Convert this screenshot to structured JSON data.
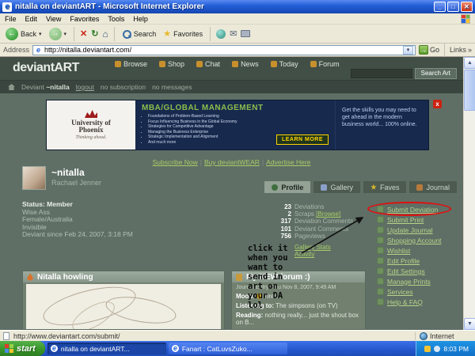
{
  "colors": {
    "xp_blue": "#2460d8",
    "start_green": "#389428",
    "da_header_bg": "#424f47",
    "da_page_bg": "#5f6f65",
    "da_link_green": "#a8cc66",
    "annotation_red": "#e01010",
    "ad_navy": "#17294d",
    "ad_yellow": "#ffd400"
  },
  "icons": {
    "back": "←",
    "forward": "→",
    "stop": "✕",
    "refresh": "↻",
    "home": "⌂",
    "favorites": "★",
    "mail": "✉",
    "dropdown": "▾",
    "go": "→",
    "links_chevron": "»",
    "minimize": "_",
    "maximize": "□",
    "close": "✕",
    "ie": "e",
    "scroll_up": "▲",
    "scroll_down": "▼",
    "ad_close": "x"
  },
  "titlebar": {
    "title": "nitalla on deviantART - Microsoft Internet Explorer"
  },
  "menubar": {
    "items": [
      "File",
      "Edit",
      "View",
      "Favorites",
      "Tools",
      "Help"
    ]
  },
  "toolbar": {
    "back_label": "Back",
    "search_label": "Search",
    "favorites_label": "Favorites"
  },
  "addressbar": {
    "label": "Address",
    "url": "http://nitalla.deviantart.com/",
    "go_label": "Go",
    "links_label": "Links"
  },
  "site_header": {
    "logo": "deviantART",
    "nav": [
      "Browse",
      "Shop",
      "Chat",
      "News",
      "Today",
      "Forum"
    ],
    "search_button": "Search Art"
  },
  "subnav": {
    "deviant_label": "Deviant",
    "username": "~nitalla",
    "logout": "logout",
    "subscription": "no subscription",
    "messages": "no messages"
  },
  "ad": {
    "brand_line1": "University of",
    "brand_line2": "Phoenix",
    "tagline": "Thinking ahead.",
    "title": "MBA/GLOBAL MANAGEMENT",
    "bullets": [
      "Foundations of Problem-Based Learning",
      "Focus Influencing Business in the Global Economy",
      "Strategies for Competitive Advantage",
      "Managing the Business Enterprise",
      "Strategic Implementation and Alignment",
      "And much more"
    ],
    "cta": "LEARN MORE",
    "offer": "Get the skills you may need to get ahead in the modern business world... 100% online."
  },
  "promo": {
    "links": [
      "Subscribe Now",
      "Buy deviantWEAR",
      "Advertise Here"
    ],
    "sep": "|"
  },
  "profile": {
    "username": "~nitalla",
    "realname": "Rachael Jenner",
    "tabs": [
      "Profile",
      "Gallery",
      "Faves",
      "Journal"
    ],
    "status": "Status: Member",
    "details": [
      "Wise Ass",
      "Female/Australia",
      "Invisible",
      "Deviant since Feb 24, 2007, 3:18 PM"
    ],
    "stats": [
      {
        "value": "23",
        "label": "Deviations"
      },
      {
        "value": "2",
        "label": "Scraps",
        "link": "[Browse]"
      },
      {
        "value": "317",
        "label": "Deviation Comments"
      },
      {
        "value": "101",
        "label": "Deviant Comments"
      },
      {
        "value": "756",
        "label": "Pageviews"
      }
    ],
    "stat_links": [
      "Gallery Stats",
      "Activity"
    ],
    "sidebar_links": [
      "Submit Deviation",
      "Submit Print",
      "Update Journal",
      "Shopping Account",
      "Wishlist",
      "Edit Profile",
      "Edit Settings",
      "Manage Prints",
      "Services",
      "Help & FAQ"
    ]
  },
  "annotation": {
    "text": "click it\nwhen you\nwant to\nsend in\nart on\nyour DA\nlol"
  },
  "left_box": {
    "title": "Nitalla howling"
  },
  "right_box": {
    "title": "My NEW forum :)",
    "journal_meta": "Journal Entry: Thu Nov 8, 2007, 9:49 AM",
    "mood_label": "Mood:",
    "mood": "Tired",
    "listening_label": "Listening to:",
    "listening": "The simpsons (on TV)",
    "reading_label": "Reading:",
    "reading": "nothing really... just the shout box on B..."
  },
  "statusbar": {
    "url": "http://www.deviantart.com/submit/",
    "zone": "Internet"
  },
  "taskbar": {
    "start": "start",
    "tasks": [
      "nitalla on deviantART...",
      "Fanart : CatLuvsZuko..."
    ],
    "time": "8:03 PM"
  }
}
